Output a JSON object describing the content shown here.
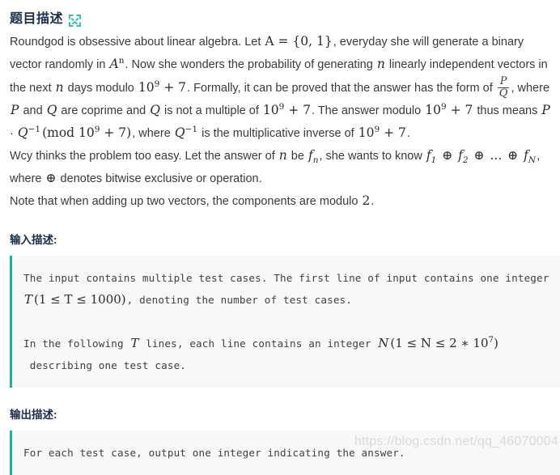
{
  "header": {
    "title": "题目描述",
    "expand_icon": "expand-arrows-icon",
    "icon_color": "#2bbfa4"
  },
  "theme": {
    "accent": "#1bb394",
    "heading_color": "#1b2e4b",
    "body_text": "#3a3a3a",
    "code_bg": "#f8f8f8",
    "watermark_color": "#d8d8dd"
  },
  "description": {
    "paragraph1": {
      "t1": "Roundgod is obsessive about linear algebra. Let ",
      "m1": "A = {0, 1}",
      "t2": ", everyday she will generate a binary vector randomly in ",
      "m2": "A",
      "m2sup": "n",
      "t3": ". Now she wonders the probability of generating ",
      "m3": "n",
      "t4": " linearly independent vectors in the next ",
      "m4": "n",
      "t5": " days modulo ",
      "m5": "10",
      "m5sup": "9",
      "m5b": " + 7",
      "t6": ". Formally, it can be proved that the answer has the form of ",
      "frac_num": "P",
      "frac_den": "Q",
      "t7": ", where ",
      "m6": "P",
      "t8": " and ",
      "m7": "Q",
      "t9": " are coprime and ",
      "m8": "Q",
      "t10": " is not a multiple of ",
      "m9": "10",
      "m9sup": "9",
      "m9b": " + 7",
      "t11": ". The answer modulo ",
      "m10": "10",
      "m10sup": "9",
      "m10b": " + 7",
      "t12": " thus means ",
      "m11": "P",
      "t13": " · ",
      "m12": "Q",
      "m12sup": "−1",
      "m13": "(mod 10",
      "m13sup": "9",
      "m13b": " + 7)",
      "t14": ", where ",
      "m14": "Q",
      "m14sup": "−1",
      "t15": " is the multiplicative inverse of ",
      "m15": "10",
      "m15sup": "9",
      "m15b": " + 7",
      "t16": "."
    },
    "paragraph2": {
      "t1": "Wcy thinks the problem too easy. Let the answer of ",
      "m1": "n",
      "t2": " be ",
      "m2": "f",
      "m2sub": "n",
      "t3": ", she wants to know ",
      "m3": "f",
      "m3sub": "1",
      "op1": " ⊕ ",
      "m4": "f",
      "m4sub": "2",
      "op2": " ⊕ ",
      "ellipsis": "...",
      "op3": " ⊕ ",
      "m5": "f",
      "m5sub": "N",
      "t4": ", where ",
      "op4": "⊕",
      "t5": " denotes bitwise exclusive or operation."
    },
    "paragraph3": {
      "t1": "Note that when adding up two vectors, the components are modulo ",
      "m1": "2",
      "t2": "."
    }
  },
  "input_section": {
    "heading": "输入描述:",
    "line1a": "The input contains multiple test cases. The first line of input contains one integer ",
    "line1_m": "T",
    "line1_range": "(1 ≤ T ≤ 1000)",
    "line1b": ", denoting the number of test cases.",
    "line2a": "In the following ",
    "line2_m": "T",
    "line2b": " lines, each line contains an integer ",
    "line2_n": "N",
    "line2_range": "(1 ≤ N ≤ 2 ∗ 10",
    "line2_range_sup": "7",
    "line2_range_end": ")",
    "line3": " describing one test case."
  },
  "output_section": {
    "heading": "输出描述:",
    "line1": "For each test case, output one integer indicating the answer."
  },
  "watermark": {
    "text": "https://blog.csdn.net/qq_46070004"
  }
}
